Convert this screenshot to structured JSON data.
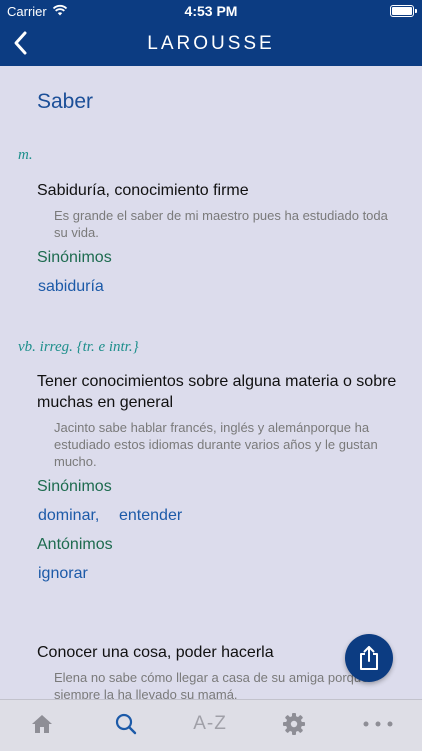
{
  "status_bar": {
    "carrier": "Carrier",
    "time": "4:53 PM"
  },
  "header": {
    "brand": "LAROUSSE"
  },
  "entry": {
    "headword": "Saber",
    "senses": [
      {
        "pos": "m.",
        "definition": "Sabiduría, conocimiento firme",
        "example": "Es grande el saber de mi maestro pues ha estudiado toda su vida.",
        "synonyms_label": "Sinónimos",
        "synonyms": [
          "sabiduría"
        ]
      },
      {
        "pos": "vb. irreg. {tr. e intr.}",
        "definition": "Tener conocimientos sobre alguna materia o sobre muchas en general",
        "example": "Jacinto sabe hablar francés, inglés y alemánporque ha estudiado estos idiomas durante varios años y le gustan mucho.",
        "synonyms_label": "Sinónimos",
        "synonyms": [
          "dominar,",
          "entender"
        ],
        "antonyms_label": "Antónimos",
        "antonyms": [
          "ignorar"
        ]
      },
      {
        "definition": "Conocer una cosa, poder hacerla",
        "example": "Elena no sabe cómo llegar a casa de su amiga porque siempre la ha llevado su mamá."
      }
    ]
  },
  "tabbar": {
    "items": [
      {
        "icon": "home-icon",
        "active": false
      },
      {
        "icon": "search-icon",
        "active": true
      },
      {
        "label": "A-Z",
        "active": false
      },
      {
        "icon": "gear-icon",
        "active": false
      },
      {
        "icon": "more-icon",
        "active": false
      }
    ]
  },
  "colors": {
    "header_bg": "#0c3c82",
    "page_bg": "#dcdcec",
    "accent": "#1c5aa8",
    "pos_teal": "#1e8f8c",
    "label_green": "#1d6b4f",
    "tab_active": "#1c5aa8",
    "tab_inactive": "#8e8e96"
  }
}
